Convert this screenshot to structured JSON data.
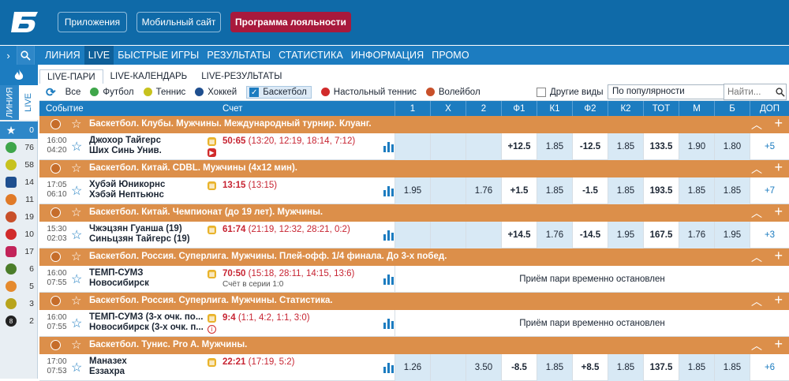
{
  "top": {
    "buttons": [
      "Приложения",
      "Мобильный сайт",
      "Программа лояльности"
    ]
  },
  "nav": {
    "items": [
      "ЛИНИЯ",
      "LIVE",
      "БЫСТРЫЕ ИГРЫ",
      "РЕЗУЛЬТАТЫ",
      "СТАТИСТИКА",
      "ИНФОРМАЦИЯ",
      "ПРОМО"
    ],
    "active": "LIVE"
  },
  "subtabs": [
    "LIVE-ПАРИ",
    "LIVE-КАЛЕНДАРЬ",
    "LIVE-РЕЗУЛЬТАТЫ"
  ],
  "left": {
    "tab_line": "ЛИНИЯ",
    "tab_live": "LIVE",
    "counts": [
      "0",
      "76",
      "58",
      "14",
      "11",
      "19",
      "10",
      "17",
      "6",
      "5",
      "3",
      "2"
    ]
  },
  "filters": {
    "all": "Все",
    "football": "Футбол",
    "tennis": "Теннис",
    "hockey": "Хоккей",
    "basketball": "Баскетбол",
    "table_tennis": "Настольный теннис",
    "volleyball": "Волейбол",
    "other": "Другие виды",
    "sort_select": "По популярности",
    "search_placeholder": "Найти..."
  },
  "header": {
    "event": "Событие",
    "score": "Счет",
    "cols": [
      "1",
      "X",
      "2",
      "Ф1",
      "К1",
      "Ф2",
      "К2",
      "ТОТ",
      "М",
      "Б",
      "ДОП"
    ]
  },
  "leagues": [
    "Баскетбол. Клубы. Мужчины. Международный турнир. Клуанг.",
    "Баскетбол. Китай. CDBL. Мужчины (4х12 мин).",
    "Баскетбол. Китай. Чемпионат (до 19 лет). Мужчины.",
    "Баскетбол. Россия. Суперлига. Мужчины. Плей-офф. 1/4 финала. До 3-х побед.",
    "Баскетбол. Россия. Суперлига. Мужчины. Статистика.",
    "Баскетбол. Тунис. Pro A. Мужчины."
  ],
  "events": [
    {
      "date": "16:00",
      "time": "04:20",
      "team1": "Джохор Тайгерс",
      "team2": "Ших Синь Унив.",
      "score": "50:65",
      "detail": "(13:20, 12:19, 18:14, 7:12)",
      "sub": "",
      "odds": [
        "",
        "",
        "",
        "+12.5",
        "1.85",
        "-12.5",
        "1.85",
        "133.5",
        "1.90",
        "1.80",
        "+5"
      ],
      "suspended": ""
    },
    {
      "date": "17:05",
      "time": "06:10",
      "team1": "Хубэй Юникорнс",
      "team2": "Хэбэй Нептьюнс",
      "score": "13:15",
      "detail": "(13:15)",
      "sub": "",
      "odds": [
        "1.95",
        "",
        "1.76",
        "+1.5",
        "1.85",
        "-1.5",
        "1.85",
        "193.5",
        "1.85",
        "1.85",
        "+7"
      ],
      "suspended": ""
    },
    {
      "date": "15:30",
      "time": "02:03",
      "team1": "Чжэцзян Гуанша (19)",
      "team2": "Синьцзян Тайгерс (19)",
      "score": "61:74",
      "detail": "(21:19, 12:32, 28:21, 0:2)",
      "sub": "",
      "odds": [
        "",
        "",
        "",
        "+14.5",
        "1.76",
        "-14.5",
        "1.95",
        "167.5",
        "1.76",
        "1.95",
        "+3"
      ],
      "suspended": ""
    },
    {
      "date": "16:00",
      "time": "07:55",
      "team1": "ТЕМП-СУМЗ",
      "team2": "Новосибирск",
      "score": "70:50",
      "detail": "(15:18, 28:11, 14:15, 13:6)",
      "sub": "Счёт в серии 1:0",
      "odds": [],
      "suspended": "Приём пари временно остановлен"
    },
    {
      "date": "16:00",
      "time": "07:55",
      "team1": "ТЕМП-СУМЗ (3-х очк. по...",
      "team2": "Новосибирск (3-х очк. п...",
      "score": "9:4",
      "detail": "(1:1, 4:2, 1:1, 3:0)",
      "sub": "",
      "odds": [],
      "suspended": "Приём пари временно остановлен"
    },
    {
      "date": "17:00",
      "time": "07:53",
      "team1": "Маназех",
      "team2": "Еззахра",
      "score": "22:21",
      "detail": "(17:19, 5:2)",
      "sub": "",
      "odds": [
        "1.26",
        "",
        "3.50",
        "-8.5",
        "1.85",
        "+8.5",
        "1.85",
        "137.5",
        "1.85",
        "1.85",
        "+6"
      ],
      "suspended": ""
    }
  ]
}
